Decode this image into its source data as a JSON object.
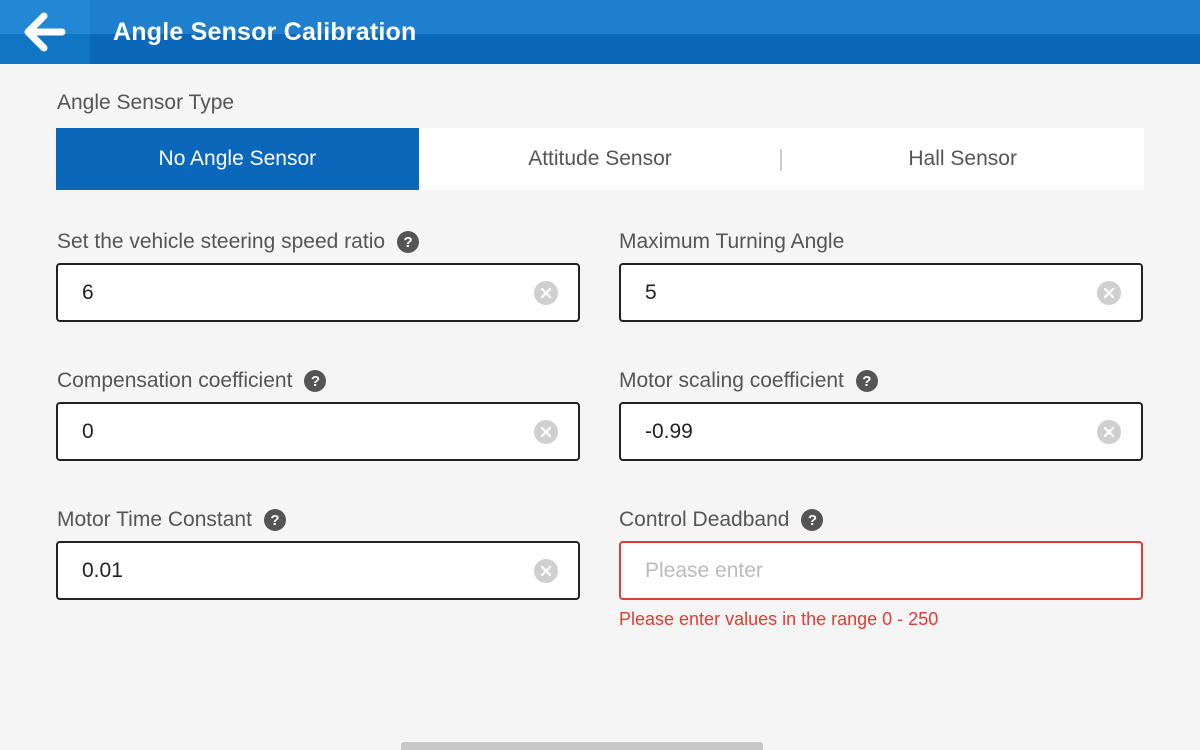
{
  "header": {
    "title": "Angle Sensor Calibration"
  },
  "sensor_type": {
    "label": "Angle Sensor Type",
    "options": [
      "No Angle Sensor",
      "Attitude Sensor",
      "Hall Sensor"
    ],
    "selected": "No Angle Sensor"
  },
  "fields": {
    "steering_ratio": {
      "label": "Set the vehicle steering speed ratio",
      "value": "6"
    },
    "max_turning_angle": {
      "label": "Maximum Turning Angle",
      "value": "5"
    },
    "compensation": {
      "label": "Compensation coefficient",
      "value": "0"
    },
    "motor_scaling": {
      "label": "Motor scaling coefficient",
      "value": "-0.99"
    },
    "motor_time_constant": {
      "label": "Motor Time Constant",
      "value": "0.01"
    },
    "control_deadband": {
      "label": "Control Deadband",
      "value": "",
      "placeholder": "Please enter",
      "error": "Please enter values in the range 0 - 250"
    }
  },
  "help_glyph": "?",
  "colors": {
    "primary": "#0b67b9",
    "error": "#e53935"
  }
}
